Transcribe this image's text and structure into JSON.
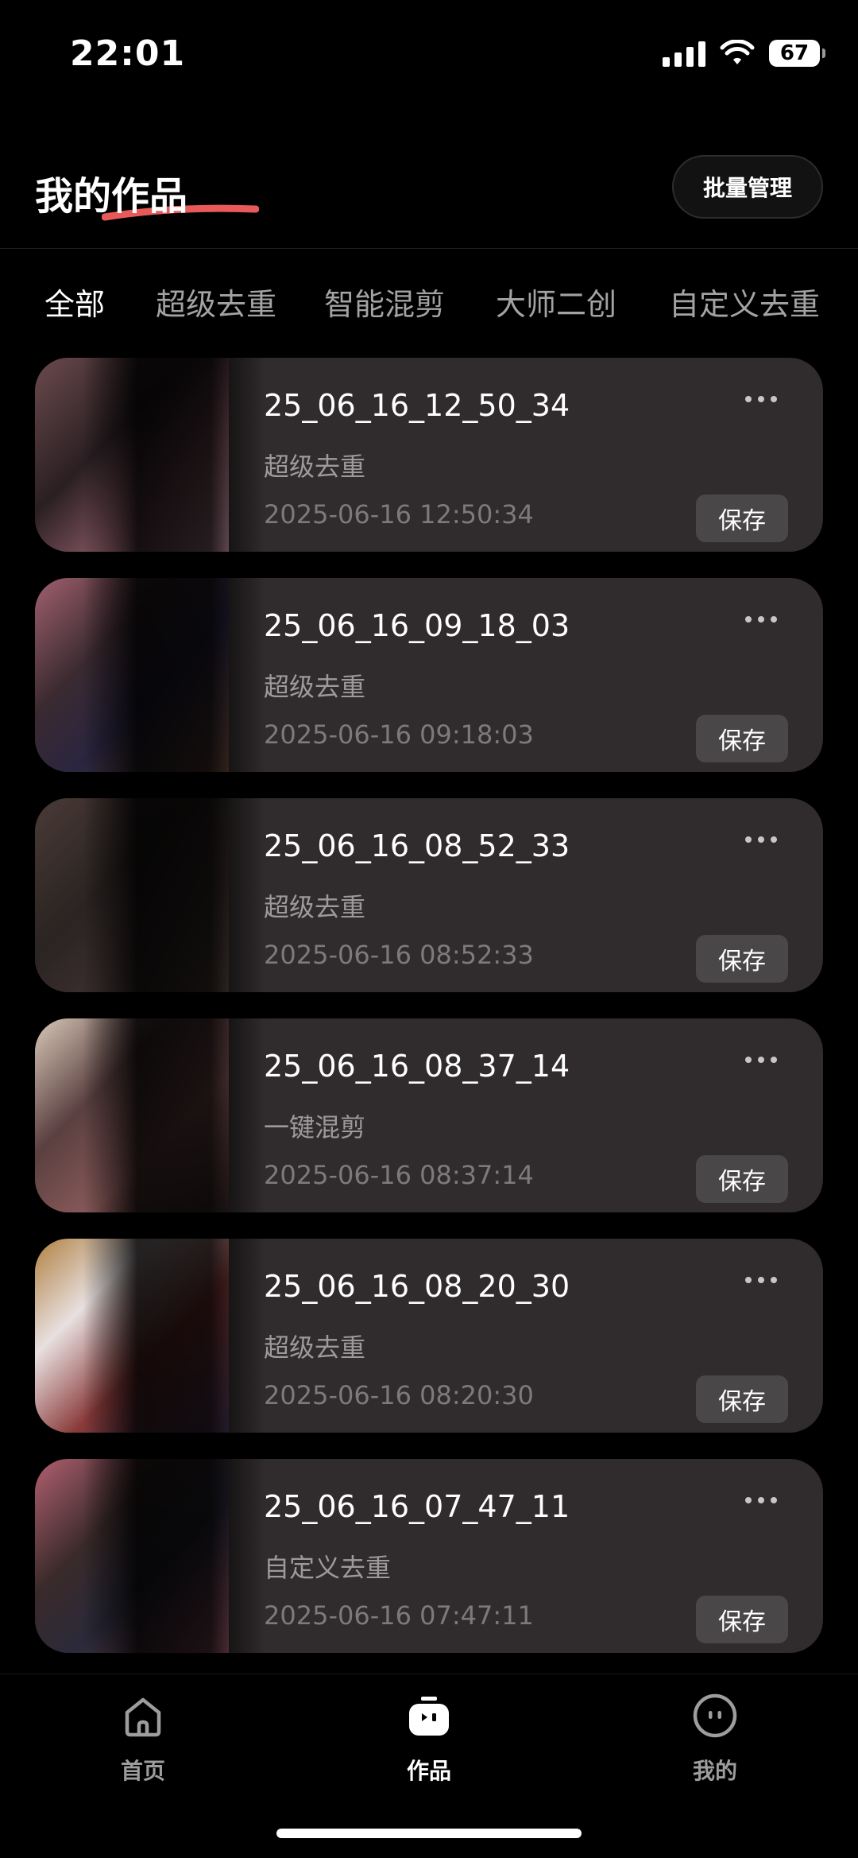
{
  "status_bar": {
    "time": "22:01",
    "battery": "67",
    "icons": [
      "signal-icon",
      "wifi-icon",
      "battery-icon"
    ]
  },
  "header": {
    "title": "我的作品",
    "batch_button": "批量管理",
    "accent_color": "#e85a5a"
  },
  "tabs": [
    {
      "label": "全部",
      "active": true
    },
    {
      "label": "超级去重",
      "active": false
    },
    {
      "label": "智能混剪",
      "active": false
    },
    {
      "label": "大师二创",
      "active": false
    },
    {
      "label": "自定义去重",
      "active": false
    }
  ],
  "works": [
    {
      "title": "25_06_16_12_50_34",
      "type": "超级去重",
      "date": "2025-06-16 12:50:34",
      "save": "保存"
    },
    {
      "title": "25_06_16_09_18_03",
      "type": "超级去重",
      "date": "2025-06-16 09:18:03",
      "save": "保存"
    },
    {
      "title": "25_06_16_08_52_33",
      "type": "超级去重",
      "date": "2025-06-16 08:52:33",
      "save": "保存"
    },
    {
      "title": "25_06_16_08_37_14",
      "type": "一键混剪",
      "date": "2025-06-16 08:37:14",
      "save": "保存"
    },
    {
      "title": "25_06_16_08_20_30",
      "type": "超级去重",
      "date": "2025-06-16 08:20:30",
      "save": "保存"
    },
    {
      "title": "25_06_16_07_47_11",
      "type": "自定义去重",
      "date": "2025-06-16 07:47:11",
      "save": "保存"
    }
  ],
  "bottom_nav": [
    {
      "label": "首页",
      "icon": "home-icon",
      "active": false
    },
    {
      "label": "作品",
      "icon": "works-icon",
      "active": true
    },
    {
      "label": "我的",
      "icon": "profile-icon",
      "active": false
    }
  ]
}
